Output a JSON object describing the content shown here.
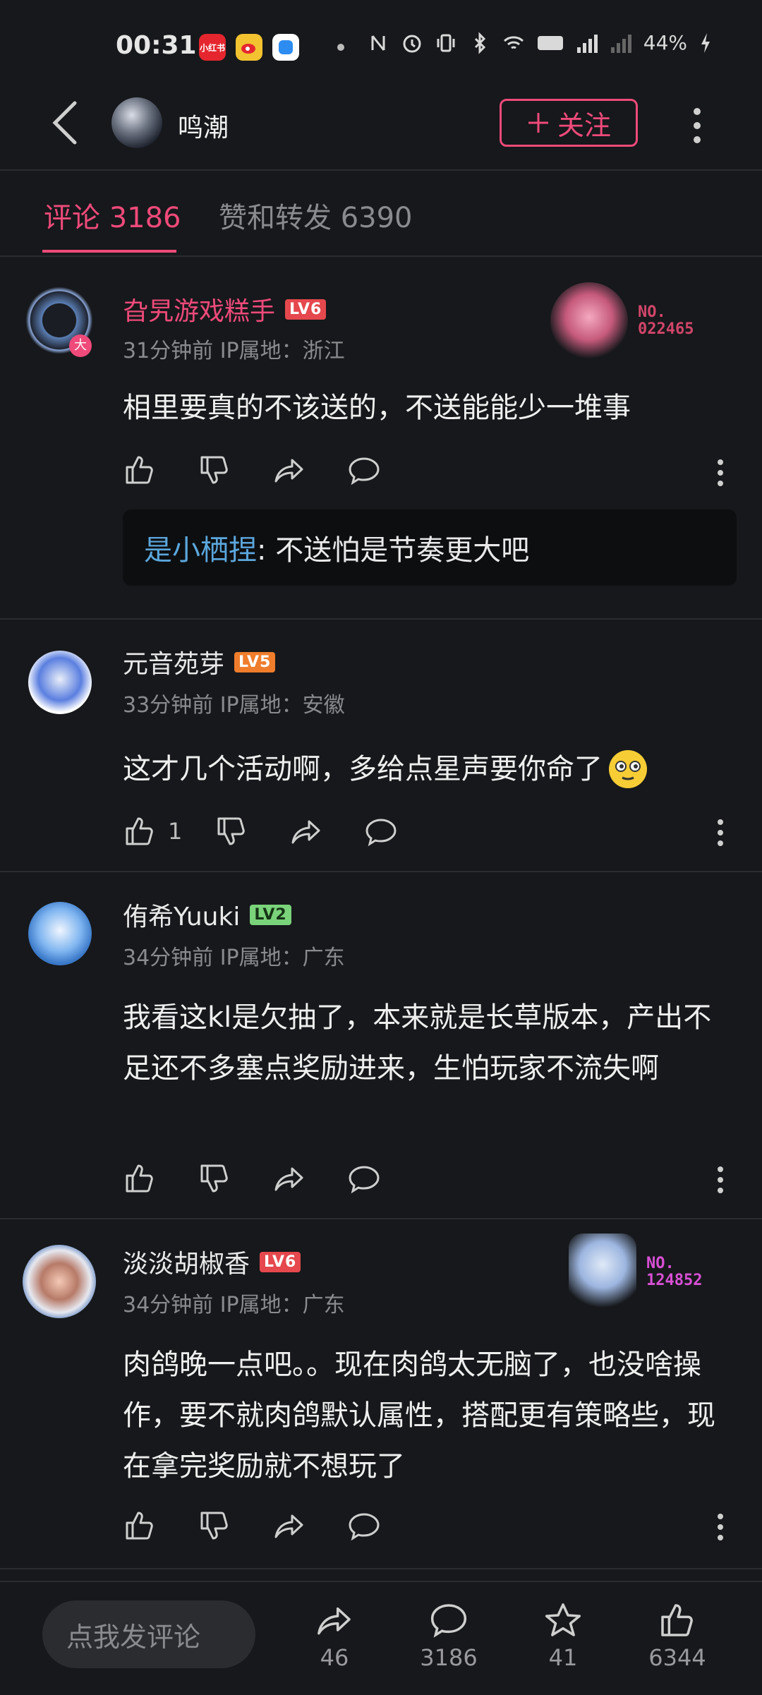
{
  "status_bar": {
    "time": "00:31",
    "battery": "44%",
    "app1": "小红书"
  },
  "header": {
    "title": "鸣潮",
    "follow_label": "关注"
  },
  "tabs": [
    {
      "label": "评论 3186"
    },
    {
      "label": "赞和转发 6390"
    }
  ],
  "comments": [
    {
      "name": "旮旯游戏糕手",
      "level": "LV6",
      "meta": "31分钟前  IP属地：浙江",
      "text": "相里要真的不该送的，不送能能少一堆事",
      "badge_no": "NO.\n022465",
      "reply": {
        "name": "是小栖捏",
        "text": ": 不送怕是节奏更大吧"
      }
    },
    {
      "name": "元音苑芽",
      "level": "LV5",
      "meta": "33分钟前  IP属地：安徽",
      "text": "这才几个活动啊，多给点星声要你命了",
      "like_count": "1"
    },
    {
      "name": "侑希Yuuki",
      "level": "LV2",
      "meta": "34分钟前  IP属地：广东",
      "text": "我看这kl是欠抽了，本来就是长草版本，产出不足还不多塞点奖励进来，生怕玩家不流失啊"
    },
    {
      "name": "淡淡胡椒香",
      "level": "LV6",
      "meta": "34分钟前  IP属地：广东",
      "text": "肉鸽晚一点吧。。现在肉鸽太无脑了，也没啥操作，要不就肉鸽默认属性，搭配更有策略些，现在拿完奖励就不想玩了",
      "badge_no": "NO.\n124852"
    }
  ],
  "bottom_bar": {
    "input_placeholder": "点我发评论",
    "share_count": "46",
    "comment_count": "3186",
    "star_count": "41",
    "like_count": "6344"
  },
  "colors": {
    "accent": "#ef4a7a",
    "background": "#16181b",
    "reply_name": "#5ba7dd"
  }
}
